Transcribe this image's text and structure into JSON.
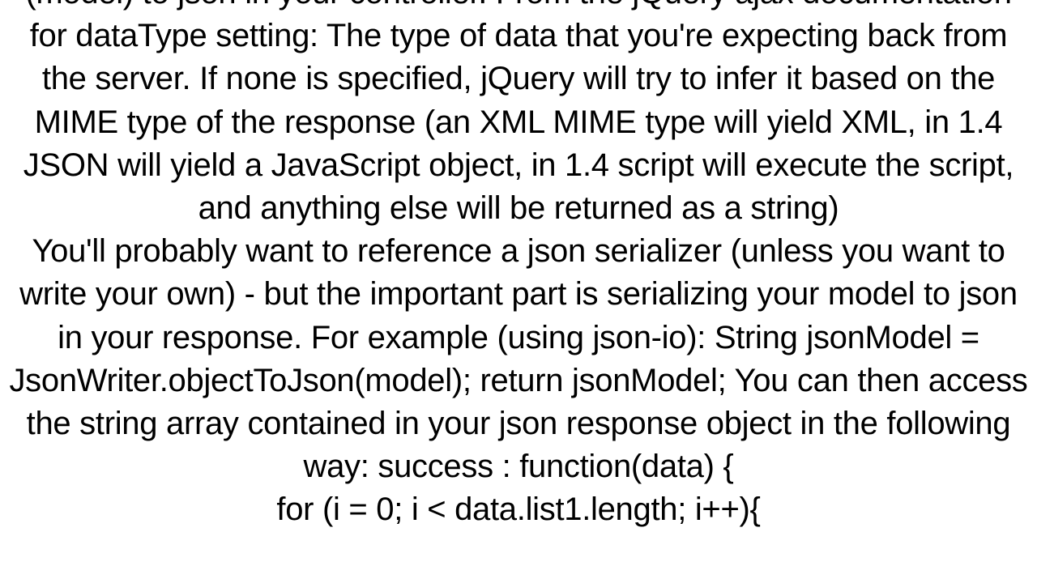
{
  "content": {
    "para1": "(model) to json in your controller. From the jQuery ajax documentation for dataType setting:  The type of data that you're expecting back from the server. If none is specified, jQuery will try to infer it based on the MIME type of the response (an XML MIME type will yield XML, in 1.4 JSON will yield a JavaScript object, in 1.4 script will execute the script, and anything else will be returned as a string)",
    "para2": "You'll probably want to reference a json serializer (unless you want to write your own) - but the important part is serializing your model to json in your response. For example (using json-io): String jsonModel = JsonWriter.objectToJson(model); return jsonModel;  You can then access the string array contained in your json response object in the following way: success : function(data) {",
    "para3": "for (i = 0; i < data.list1.length; i++){"
  }
}
